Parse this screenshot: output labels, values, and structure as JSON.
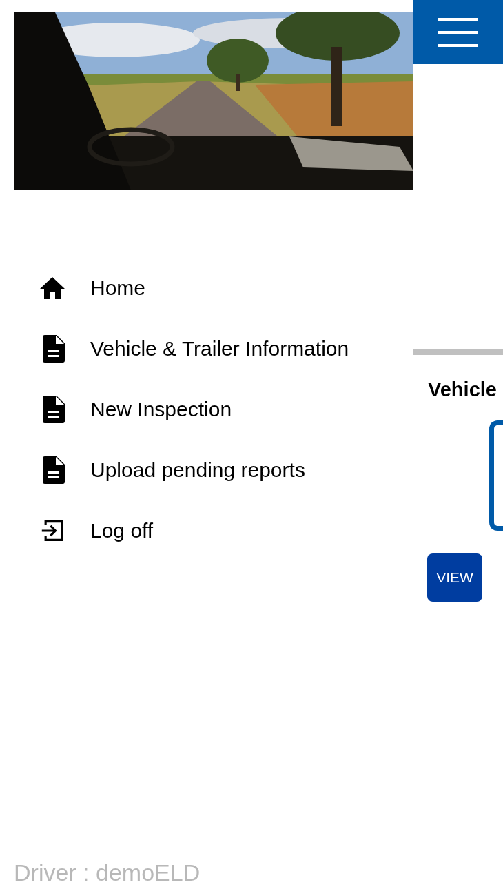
{
  "drawer": {
    "items": [
      {
        "kind": "home",
        "label": "Home"
      },
      {
        "kind": "document",
        "label": "Vehicle & Trailer Information"
      },
      {
        "kind": "document",
        "label": "New Inspection"
      },
      {
        "kind": "document",
        "label": "Upload pending reports"
      },
      {
        "kind": "logout",
        "label": "Log off"
      }
    ],
    "footer": "Driver : demoELD"
  },
  "main": {
    "heading": "Vehicle",
    "button": "VIEW"
  }
}
